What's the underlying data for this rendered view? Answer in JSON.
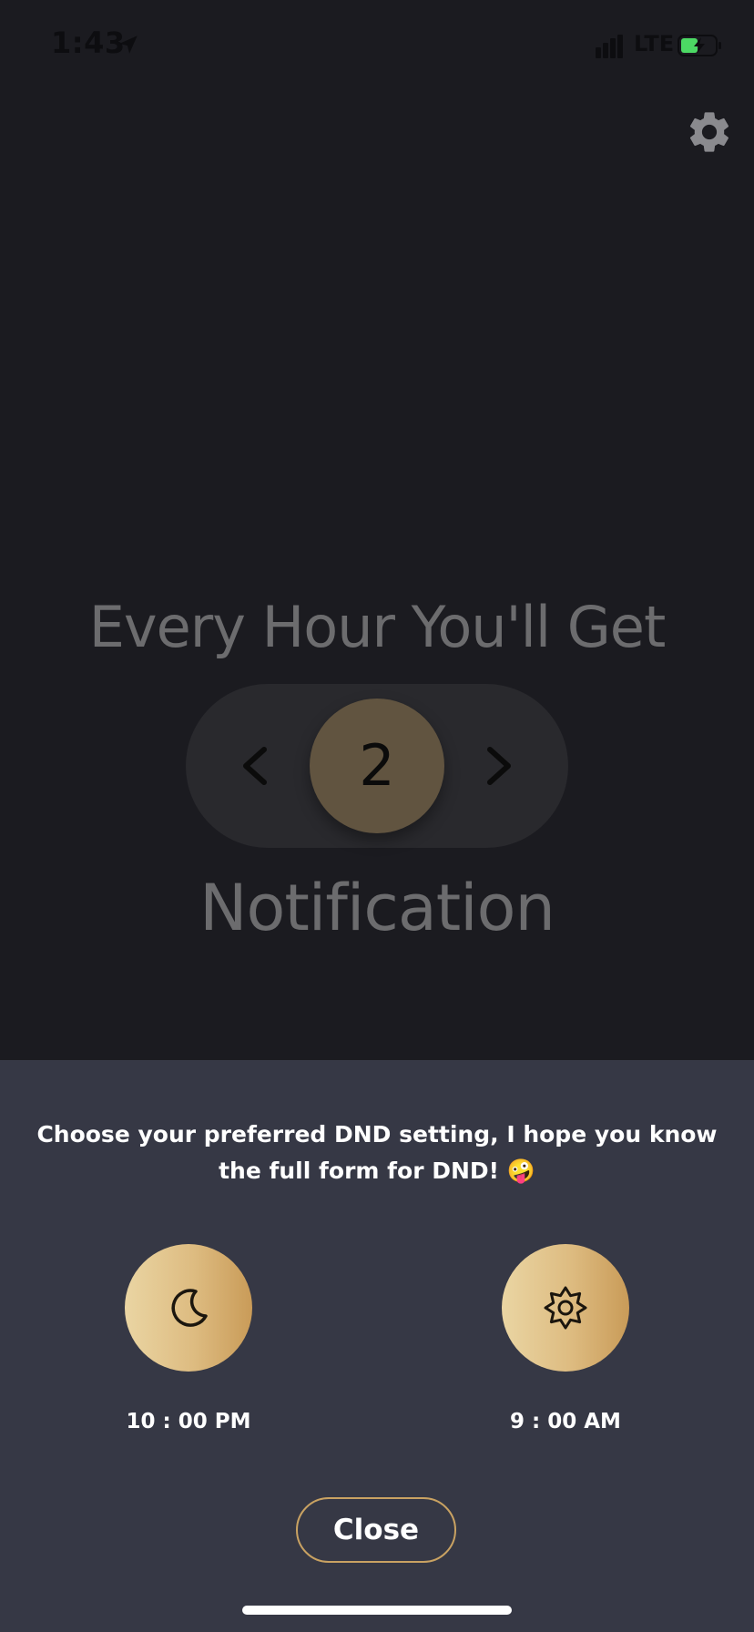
{
  "status_bar": {
    "time": "1:43",
    "network": "LTE",
    "icons": [
      "location-arrow-icon",
      "signal-icon",
      "battery-charging-icon"
    ]
  },
  "header": {
    "settings_icon": "gear-icon"
  },
  "main": {
    "headline": "Every Hour You'll Get",
    "stepper": {
      "value": "2",
      "prev_icon": "chevron-left-icon",
      "next_icon": "chevron-right-icon"
    },
    "subline": "Notification"
  },
  "dnd_sheet": {
    "message": "Choose your preferred DND setting, I hope you know the full form for DND! 🤪",
    "start": {
      "icon": "moon-icon",
      "time": "10 : 00 PM"
    },
    "end": {
      "icon": "sun-icon",
      "time": "9 : 00 AM"
    },
    "close_label": "Close"
  },
  "colors": {
    "background": "#1b1b20",
    "sheet": "#363845",
    "accent_gold": "#c9a262",
    "stepper_value_bg": "#615440",
    "text_muted": "#6c6c6e"
  }
}
